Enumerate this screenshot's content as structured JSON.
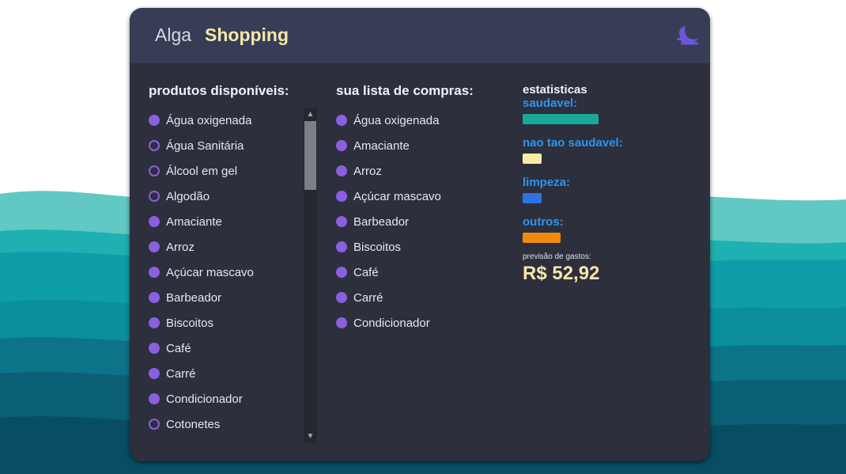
{
  "brand": {
    "light": "Alga",
    "bold": "Shopping"
  },
  "theme_icon": "moon-icon",
  "available": {
    "title": "produtos disponíveis:",
    "items": [
      {
        "label": "Água oxigenada",
        "selected": true
      },
      {
        "label": "Água Sanitária",
        "selected": false
      },
      {
        "label": "Álcool em gel",
        "selected": false
      },
      {
        "label": "Algodão",
        "selected": false
      },
      {
        "label": "Amaciante",
        "selected": true
      },
      {
        "label": "Arroz",
        "selected": true
      },
      {
        "label": "Açúcar mascavo",
        "selected": true
      },
      {
        "label": "Barbeador",
        "selected": true
      },
      {
        "label": "Biscoitos",
        "selected": true
      },
      {
        "label": "Café",
        "selected": true
      },
      {
        "label": "Carré",
        "selected": true
      },
      {
        "label": "Condicionador",
        "selected": true
      },
      {
        "label": "Cotonetes",
        "selected": false
      }
    ]
  },
  "shopping_list": {
    "title": "sua lista de compras:",
    "items": [
      {
        "label": "Água oxigenada"
      },
      {
        "label": "Amaciante"
      },
      {
        "label": "Arroz"
      },
      {
        "label": "Açúcar mascavo"
      },
      {
        "label": "Barbeador"
      },
      {
        "label": "Biscoitos"
      },
      {
        "label": "Café"
      },
      {
        "label": "Carré"
      },
      {
        "label": "Condicionador"
      }
    ]
  },
  "stats": {
    "title": "estatisticas",
    "categories": [
      {
        "label": "saudavel:",
        "color": "#1aa89a",
        "share": 0.6
      },
      {
        "label": "nao tao saudavel:",
        "color": "#f6eca5",
        "share": 0.15
      },
      {
        "label": "limpeza:",
        "color": "#2f73e0",
        "share": 0.15
      },
      {
        "label": "outros:",
        "color": "#f18a0b",
        "share": 0.3
      }
    ],
    "forecast_label": "previsão de gastos:",
    "forecast_value": "R$ 52,92"
  },
  "colors": {
    "accent": "#8b5fe0",
    "stat_label": "#2d95ee",
    "highlight": "#f6e7a8"
  }
}
